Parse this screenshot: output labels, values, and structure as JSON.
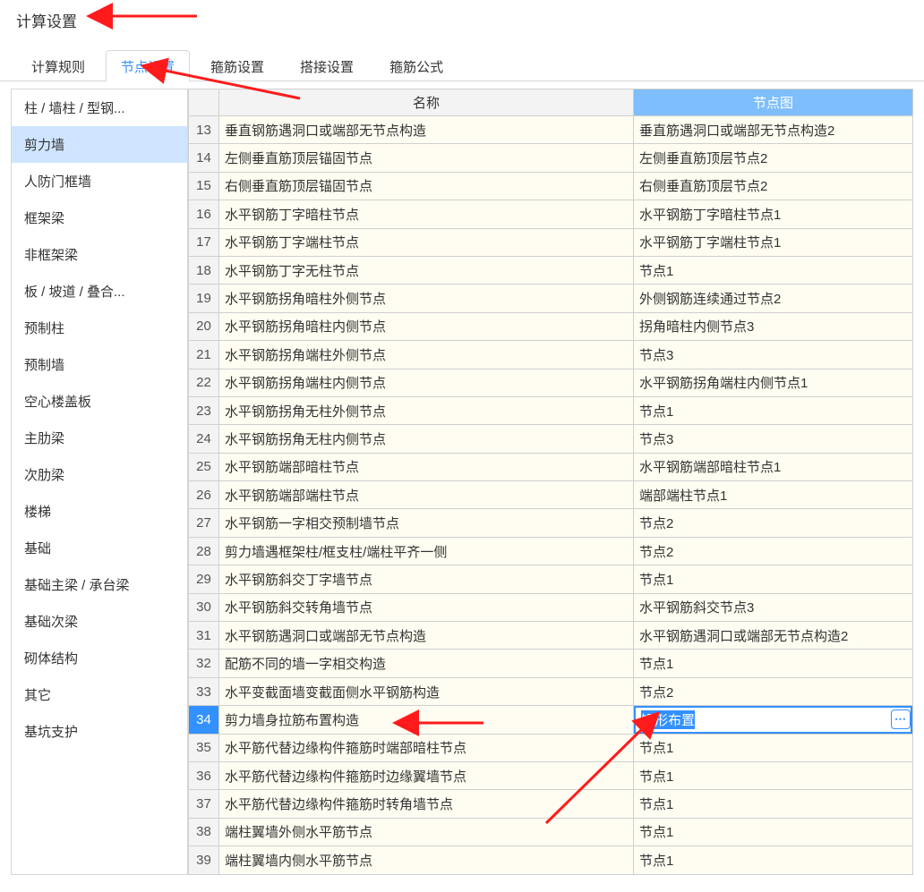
{
  "title": "计算设置",
  "tabs": [
    {
      "label": "计算规则",
      "active": false
    },
    {
      "label": "节点设置",
      "active": true
    },
    {
      "label": "箍筋设置",
      "active": false
    },
    {
      "label": "搭接设置",
      "active": false
    },
    {
      "label": "箍筋公式",
      "active": false
    }
  ],
  "sidebar": {
    "items": [
      {
        "label": "柱 / 墙柱 / 型钢...",
        "selected": false
      },
      {
        "label": "剪力墙",
        "selected": true
      },
      {
        "label": "人防门框墙",
        "selected": false
      },
      {
        "label": "框架梁",
        "selected": false
      },
      {
        "label": "非框架梁",
        "selected": false
      },
      {
        "label": "板 / 坡道 / 叠合...",
        "selected": false
      },
      {
        "label": "预制柱",
        "selected": false
      },
      {
        "label": "预制墙",
        "selected": false
      },
      {
        "label": "空心楼盖板",
        "selected": false
      },
      {
        "label": "主肋梁",
        "selected": false
      },
      {
        "label": "次肋梁",
        "selected": false
      },
      {
        "label": "楼梯",
        "selected": false
      },
      {
        "label": "基础",
        "selected": false
      },
      {
        "label": "基础主梁 / 承台梁",
        "selected": false
      },
      {
        "label": "基础次梁",
        "selected": false
      },
      {
        "label": "砌体结构",
        "selected": false
      },
      {
        "label": "其它",
        "selected": false
      },
      {
        "label": "基坑支护",
        "selected": false
      }
    ]
  },
  "grid": {
    "headers": {
      "name": "名称",
      "node": "节点图"
    },
    "selected_row_value": "矩形布置",
    "rows": [
      {
        "n": 13,
        "name": "垂直钢筋遇洞口或端部无节点构造",
        "node": "垂直筋遇洞口或端部无节点构造2"
      },
      {
        "n": 14,
        "name": "左侧垂直筋顶层锚固节点",
        "node": "左侧垂直筋顶层节点2"
      },
      {
        "n": 15,
        "name": "右侧垂直筋顶层锚固节点",
        "node": "右侧垂直筋顶层节点2"
      },
      {
        "n": 16,
        "name": "水平钢筋丁字暗柱节点",
        "node": "水平钢筋丁字暗柱节点1"
      },
      {
        "n": 17,
        "name": "水平钢筋丁字端柱节点",
        "node": "水平钢筋丁字端柱节点1"
      },
      {
        "n": 18,
        "name": "水平钢筋丁字无柱节点",
        "node": "节点1"
      },
      {
        "n": 19,
        "name": "水平钢筋拐角暗柱外侧节点",
        "node": "外侧钢筋连续通过节点2"
      },
      {
        "n": 20,
        "name": "水平钢筋拐角暗柱内侧节点",
        "node": "拐角暗柱内侧节点3"
      },
      {
        "n": 21,
        "name": "水平钢筋拐角端柱外侧节点",
        "node": "节点3"
      },
      {
        "n": 22,
        "name": "水平钢筋拐角端柱内侧节点",
        "node": "水平钢筋拐角端柱内侧节点1"
      },
      {
        "n": 23,
        "name": "水平钢筋拐角无柱外侧节点",
        "node": "节点1"
      },
      {
        "n": 24,
        "name": "水平钢筋拐角无柱内侧节点",
        "node": "节点3"
      },
      {
        "n": 25,
        "name": "水平钢筋端部暗柱节点",
        "node": "水平钢筋端部暗柱节点1"
      },
      {
        "n": 26,
        "name": "水平钢筋端部端柱节点",
        "node": "端部端柱节点1"
      },
      {
        "n": 27,
        "name": "水平钢筋一字相交预制墙节点",
        "node": "节点2"
      },
      {
        "n": 28,
        "name": "剪力墙遇框架柱/框支柱/端柱平齐一侧",
        "node": "节点2"
      },
      {
        "n": 29,
        "name": "水平钢筋斜交丁字墙节点",
        "node": "节点1"
      },
      {
        "n": 30,
        "name": "水平钢筋斜交转角墙节点",
        "node": "水平钢筋斜交节点3"
      },
      {
        "n": 31,
        "name": "水平钢筋遇洞口或端部无节点构造",
        "node": "水平钢筋遇洞口或端部无节点构造2"
      },
      {
        "n": 32,
        "name": "配筋不同的墙一字相交构造",
        "node": "节点1"
      },
      {
        "n": 33,
        "name": "水平变截面墙变截面侧水平钢筋构造",
        "node": "节点2"
      },
      {
        "n": 34,
        "name": "剪力墙身拉筋布置构造",
        "node": "矩形布置",
        "selected": true
      },
      {
        "n": 35,
        "name": "水平筋代替边缘构件箍筋时端部暗柱节点",
        "node": "节点1"
      },
      {
        "n": 36,
        "name": "水平筋代替边缘构件箍筋时边缘翼墙节点",
        "node": "节点1"
      },
      {
        "n": 37,
        "name": "水平筋代替边缘构件箍筋时转角墙节点",
        "node": "节点1"
      },
      {
        "n": 38,
        "name": "端柱翼墙外侧水平筋节点",
        "node": "节点1"
      },
      {
        "n": 39,
        "name": "端柱翼墙内侧水平筋节点",
        "node": "节点1"
      }
    ]
  },
  "annotations": {
    "arrows_to": [
      "title",
      "tab-node-settings",
      "row-34-name",
      "row-34-node-cell"
    ]
  }
}
